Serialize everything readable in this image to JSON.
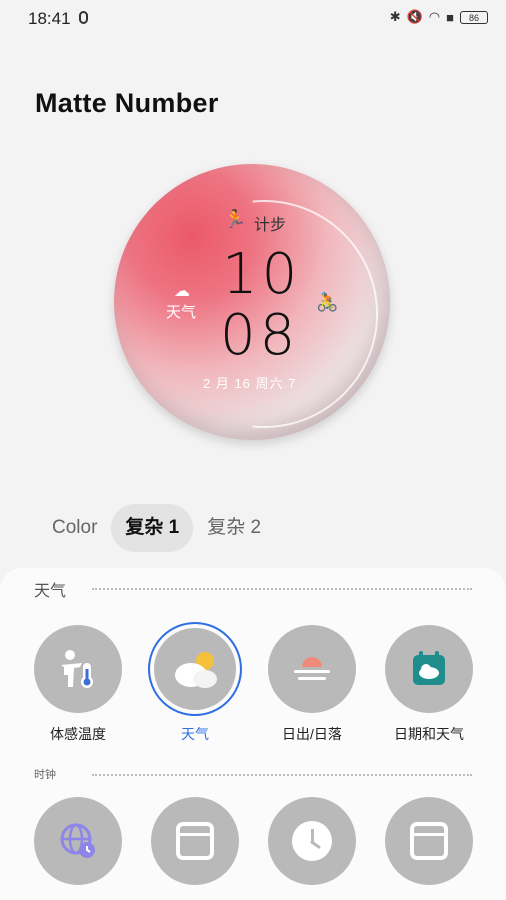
{
  "status_bar": {
    "time": "18:41",
    "battery": "86"
  },
  "page": {
    "title": "Matte Number"
  },
  "watch_face": {
    "complication_top": "计步",
    "hour": "10",
    "minute": "08",
    "complication_left": "天气",
    "date": "2 月 16 周六 7"
  },
  "tabs": [
    {
      "label": "Color"
    },
    {
      "label": "复杂 1"
    },
    {
      "label": "复杂 2"
    }
  ],
  "sections": [
    {
      "label": "天气",
      "items": [
        {
          "label": "体感温度",
          "icon": "feels-like-temperature-icon"
        },
        {
          "label": "天气",
          "icon": "weather-icon"
        },
        {
          "label": "日出/日落",
          "icon": "sunrise-sunset-icon"
        },
        {
          "label": "日期和天气",
          "icon": "date-and-weather-icon"
        }
      ]
    },
    {
      "label": "时钟",
      "items": [
        {
          "icon": "world-clock-icon"
        },
        {
          "icon": "calendar-icon"
        },
        {
          "icon": "clock-icon"
        },
        {
          "icon": "calendar-icon"
        }
      ]
    }
  ],
  "colors": {
    "accent": "#2f6fe4",
    "tile": "#b9b9b9"
  }
}
